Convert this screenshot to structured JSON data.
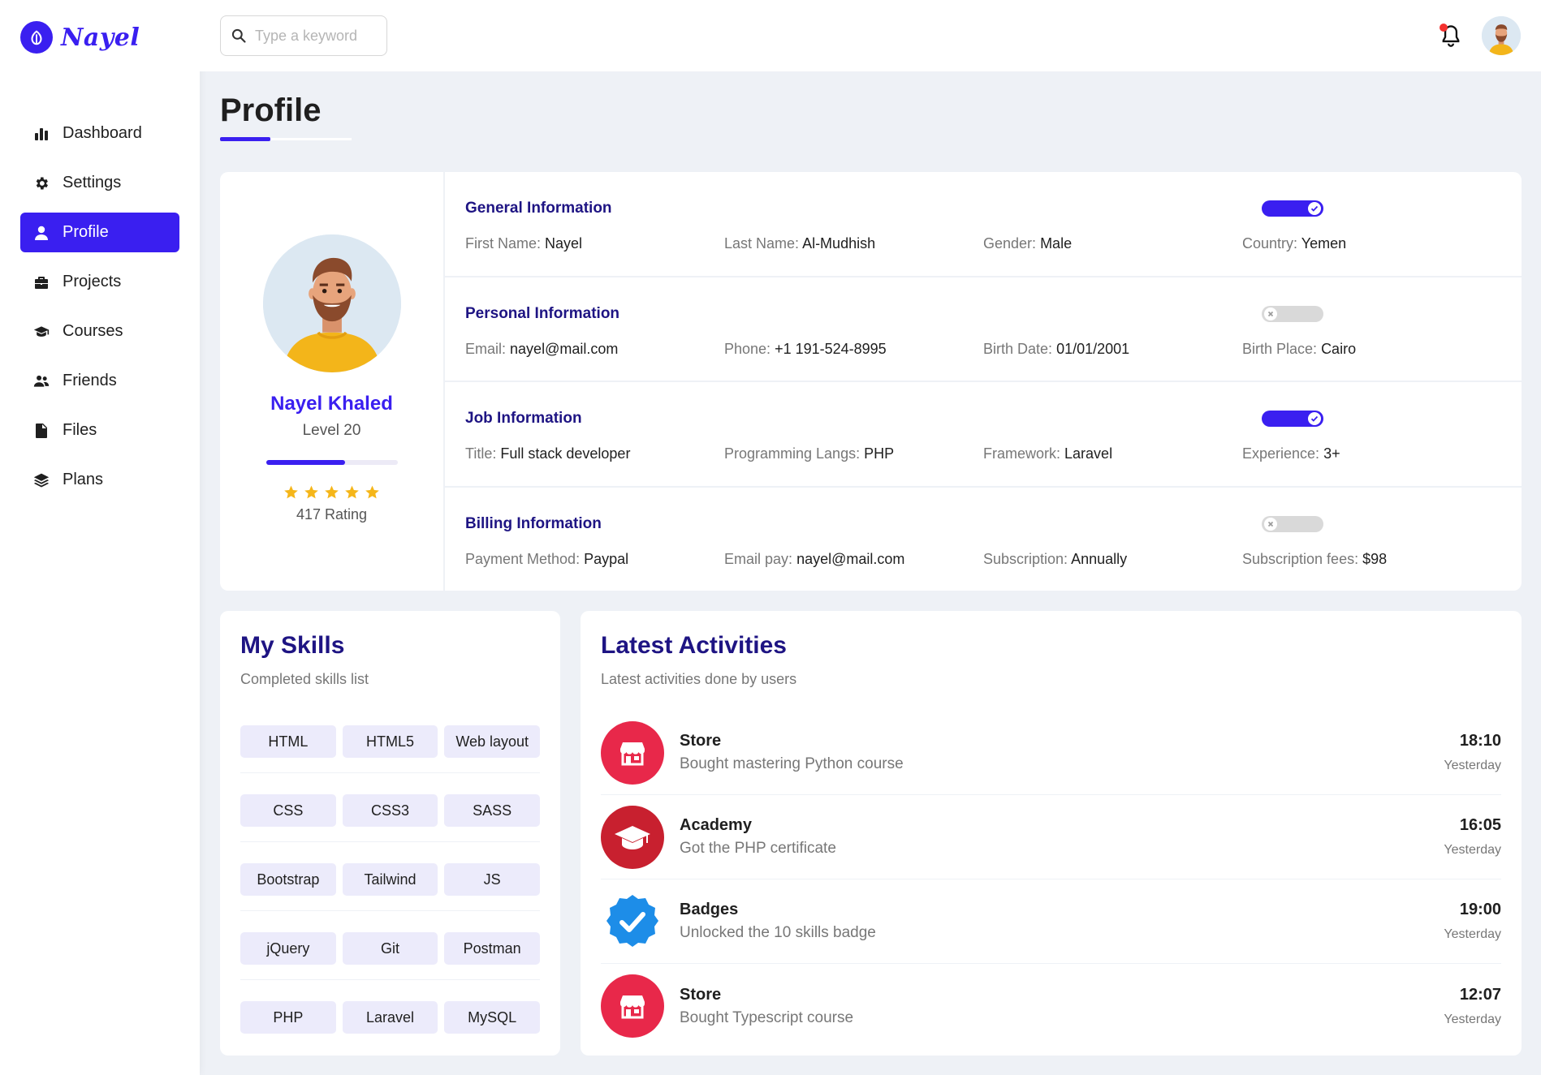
{
  "brand": {
    "name": "Nayel",
    "accent": "#3a1ff0"
  },
  "search": {
    "placeholder": "Type a keyword"
  },
  "nav": [
    {
      "label": "Dashboard",
      "icon": "chart-bar-icon",
      "active": false
    },
    {
      "label": "Settings",
      "icon": "gear-icon",
      "active": false
    },
    {
      "label": "Profile",
      "icon": "user-icon",
      "active": true
    },
    {
      "label": "Projects",
      "icon": "briefcase-icon",
      "active": false
    },
    {
      "label": "Courses",
      "icon": "graduation-cap-icon",
      "active": false
    },
    {
      "label": "Friends",
      "icon": "users-icon",
      "active": false
    },
    {
      "label": "Files",
      "icon": "file-icon",
      "active": false
    },
    {
      "label": "Plans",
      "icon": "layers-icon",
      "active": false
    }
  ],
  "page": {
    "title": "Profile"
  },
  "profile": {
    "name": "Nayel Khaled",
    "level": "Level 20",
    "level_progress": 0.6,
    "stars": 5,
    "rating": "417 Rating"
  },
  "info_blocks": [
    {
      "title": "General Information",
      "enabled": true,
      "fields": [
        {
          "label": "First Name:",
          "value": "Nayel"
        },
        {
          "label": "Last Name:",
          "value": "Al-Mudhish"
        },
        {
          "label": "Gender:",
          "value": "Male"
        },
        {
          "label": "Country:",
          "value": "Yemen"
        }
      ]
    },
    {
      "title": "Personal Information",
      "enabled": false,
      "fields": [
        {
          "label": "Email:",
          "value": "nayel@mail.com"
        },
        {
          "label": "Phone:",
          "value": "+1 191-524-8995"
        },
        {
          "label": "Birth Date:",
          "value": "01/01/2001"
        },
        {
          "label": "Birth Place:",
          "value": "Cairo"
        }
      ]
    },
    {
      "title": "Job Information",
      "enabled": true,
      "fields": [
        {
          "label": "Title:",
          "value": "Full stack developer"
        },
        {
          "label": "Programming Langs:",
          "value": "PHP"
        },
        {
          "label": "Framework:",
          "value": "Laravel"
        },
        {
          "label": "Experience:",
          "value": "3+"
        }
      ]
    },
    {
      "title": "Billing Information",
      "enabled": false,
      "fields": [
        {
          "label": "Payment Method:",
          "value": "Paypal"
        },
        {
          "label": "Email pay:",
          "value": "nayel@mail.com"
        },
        {
          "label": "Subscription:",
          "value": "Annually"
        },
        {
          "label": "Subscription fees:",
          "value": "$98"
        }
      ]
    }
  ],
  "skills": {
    "title": "My Skills",
    "subtitle": "Completed skills list",
    "rows": [
      [
        "HTML",
        "HTML5",
        "Web layout"
      ],
      [
        "CSS",
        "CSS3",
        "SASS"
      ],
      [
        "Bootstrap",
        "Tailwind",
        "JS"
      ],
      [
        "jQuery",
        "Git",
        "Postman"
      ],
      [
        "PHP",
        "Laravel",
        "MySQL"
      ]
    ]
  },
  "activities": {
    "title": "Latest Activities",
    "subtitle": "Latest activities done by users",
    "items": [
      {
        "title": "Store",
        "desc": "Bought mastering Python course",
        "time": "18:10",
        "when": "Yesterday",
        "icon": "store-icon",
        "color": "#e8284a"
      },
      {
        "title": "Academy",
        "desc": "Got the PHP certificate",
        "time": "16:05",
        "when": "Yesterday",
        "icon": "graduation-cap-icon",
        "color": "#c8202f"
      },
      {
        "title": "Badges",
        "desc": "Unlocked the 10 skills badge",
        "time": "19:00",
        "when": "Yesterday",
        "icon": "verified-badge-icon",
        "color": "#1d8de8"
      },
      {
        "title": "Store",
        "desc": "Bought Typescript course",
        "time": "12:07",
        "when": "Yesterday",
        "icon": "store-icon",
        "color": "#e8284a"
      }
    ]
  }
}
